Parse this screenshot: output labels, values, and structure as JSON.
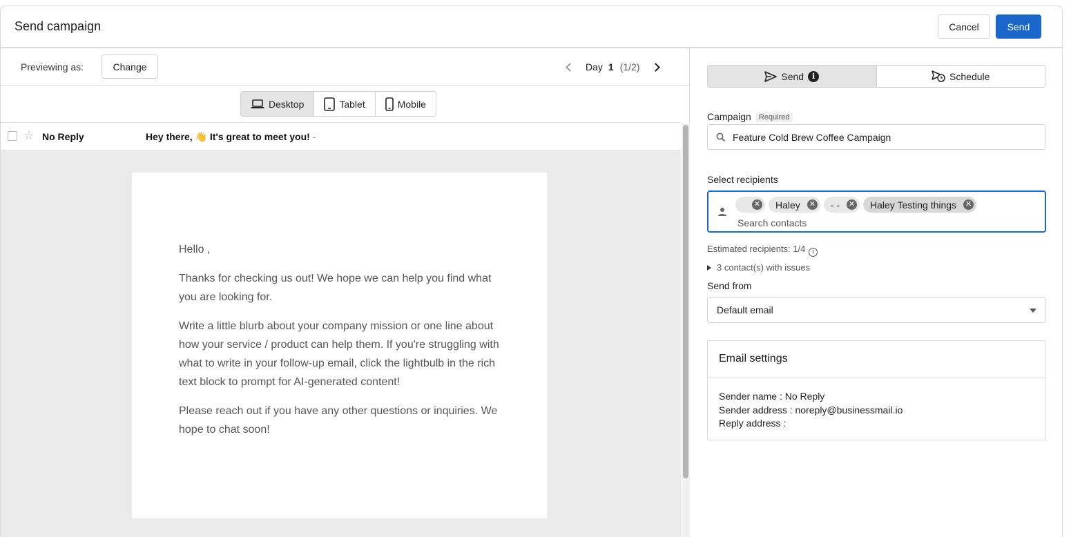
{
  "header": {
    "title": "Send campaign",
    "cancel_label": "Cancel",
    "send_label": "Send"
  },
  "preview": {
    "label": "Previewing as:",
    "change_label": "Change",
    "day_label": "Day",
    "day_number": "1",
    "day_fraction": "(1/2)",
    "devices": [
      {
        "label": "Desktop",
        "icon": "laptop-icon",
        "active": true
      },
      {
        "label": "Tablet",
        "icon": "tablet-icon",
        "active": false
      },
      {
        "label": "Mobile",
        "icon": "mobile-icon",
        "active": false
      }
    ]
  },
  "mail": {
    "sender": "No Reply",
    "subject": "Hey there, 👋 It's great to meet you!",
    "subject_suffix": "-",
    "body": [
      "Hello ,",
      "Thanks for checking us out! We hope we can help you find what you are looking for.",
      "Write a little blurb about your company mission or one line about how your service / product can help them. If you're struggling with what to write in your follow-up email, click the lightbulb in the rich text block to prompt for AI-generated content!",
      "Please reach out if you have any other questions or inquiries. We hope to chat soon!"
    ]
  },
  "panel": {
    "tabs": {
      "send": "Send",
      "schedule": "Schedule",
      "info": "i"
    },
    "campaign_label": "Campaign",
    "required_badge": "Required",
    "campaign_value": "Feature Cold Brew Coffee Campaign",
    "recipients_label": "Select recipients",
    "chips": [
      "",
      "Haley",
      "- -",
      "Haley Testing things"
    ],
    "search_placeholder": "Search contacts",
    "estimated": "Estimated recipients: 1/4",
    "issues": "3 contact(s) with issues",
    "send_from_label": "Send from",
    "send_from_value": "Default email",
    "settings_title": "Email settings",
    "sender_name": "Sender name : No Reply",
    "sender_address": "Sender address : noreply@businessmail.io",
    "reply_address": "Reply address :"
  },
  "colors": {
    "primary": "#1a66c9",
    "active_tab": "#e4e4e4",
    "canvas": "#ebebeb"
  }
}
